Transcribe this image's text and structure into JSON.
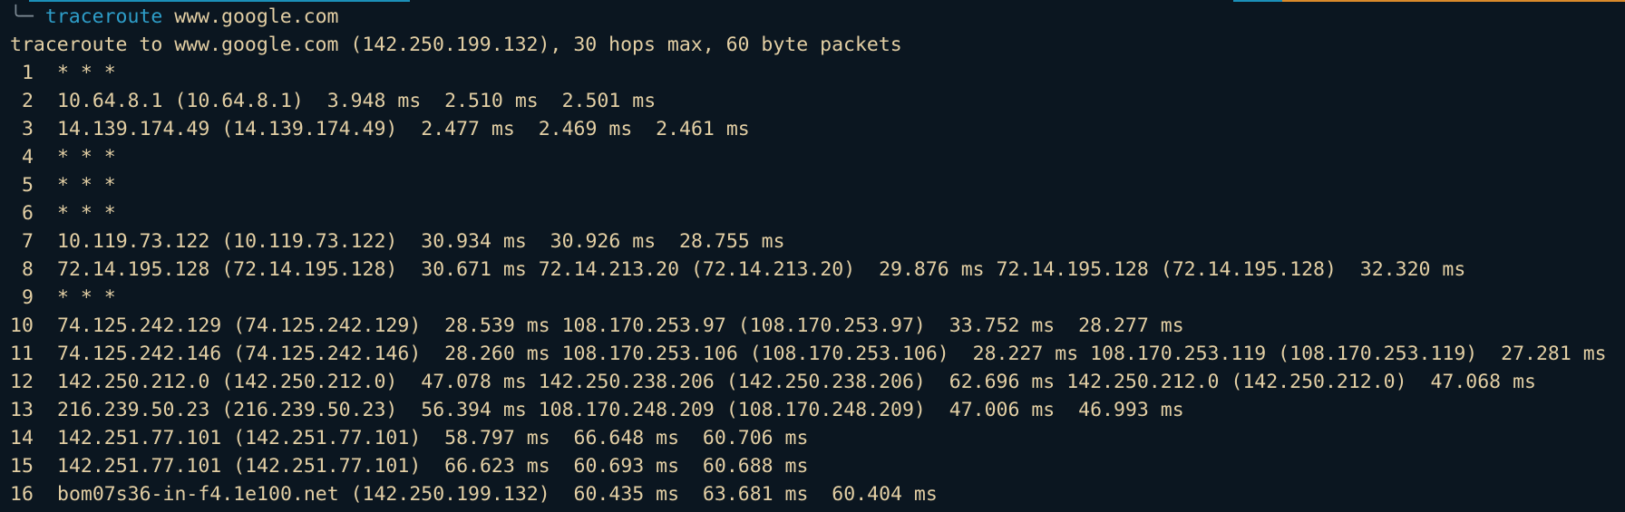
{
  "terminal": {
    "prompt_glyph": "╰─",
    "command": "traceroute",
    "argument": "www.google.com",
    "header": "traceroute to www.google.com (142.250.199.132), 30 hops max, 60 byte packets",
    "hops": [
      {
        "num": " 1",
        "text": "* * *"
      },
      {
        "num": " 2",
        "text": "10.64.8.1 (10.64.8.1)  3.948 ms  2.510 ms  2.501 ms"
      },
      {
        "num": " 3",
        "text": "14.139.174.49 (14.139.174.49)  2.477 ms  2.469 ms  2.461 ms"
      },
      {
        "num": " 4",
        "text": "* * *"
      },
      {
        "num": " 5",
        "text": "* * *"
      },
      {
        "num": " 6",
        "text": "* * *"
      },
      {
        "num": " 7",
        "text": "10.119.73.122 (10.119.73.122)  30.934 ms  30.926 ms  28.755 ms"
      },
      {
        "num": " 8",
        "text": "72.14.195.128 (72.14.195.128)  30.671 ms 72.14.213.20 (72.14.213.20)  29.876 ms 72.14.195.128 (72.14.195.128)  32.320 ms"
      },
      {
        "num": " 9",
        "text": "* * *"
      },
      {
        "num": "10",
        "text": "74.125.242.129 (74.125.242.129)  28.539 ms 108.170.253.97 (108.170.253.97)  33.752 ms  28.277 ms"
      },
      {
        "num": "11",
        "text": "74.125.242.146 (74.125.242.146)  28.260 ms 108.170.253.106 (108.170.253.106)  28.227 ms 108.170.253.119 (108.170.253.119)  27.281 ms"
      },
      {
        "num": "12",
        "text": "142.250.212.0 (142.250.212.0)  47.078 ms 142.250.238.206 (142.250.238.206)  62.696 ms 142.250.212.0 (142.250.212.0)  47.068 ms"
      },
      {
        "num": "13",
        "text": "216.239.50.23 (216.239.50.23)  56.394 ms 108.170.248.209 (108.170.248.209)  47.006 ms  46.993 ms"
      },
      {
        "num": "14",
        "text": "142.251.77.101 (142.251.77.101)  58.797 ms  66.648 ms  60.706 ms"
      },
      {
        "num": "15",
        "text": "142.251.77.101 (142.251.77.101)  66.623 ms  60.693 ms  60.688 ms"
      },
      {
        "num": "16",
        "text": "bom07s36-in-f4.1e100.net (142.250.199.132)  60.435 ms  63.681 ms  60.404 ms"
      }
    ]
  },
  "colors": {
    "background": "#0b1620",
    "text": "#e3cfa4",
    "command": "#2e9ec9",
    "accent_orange": "#d98a2b"
  }
}
